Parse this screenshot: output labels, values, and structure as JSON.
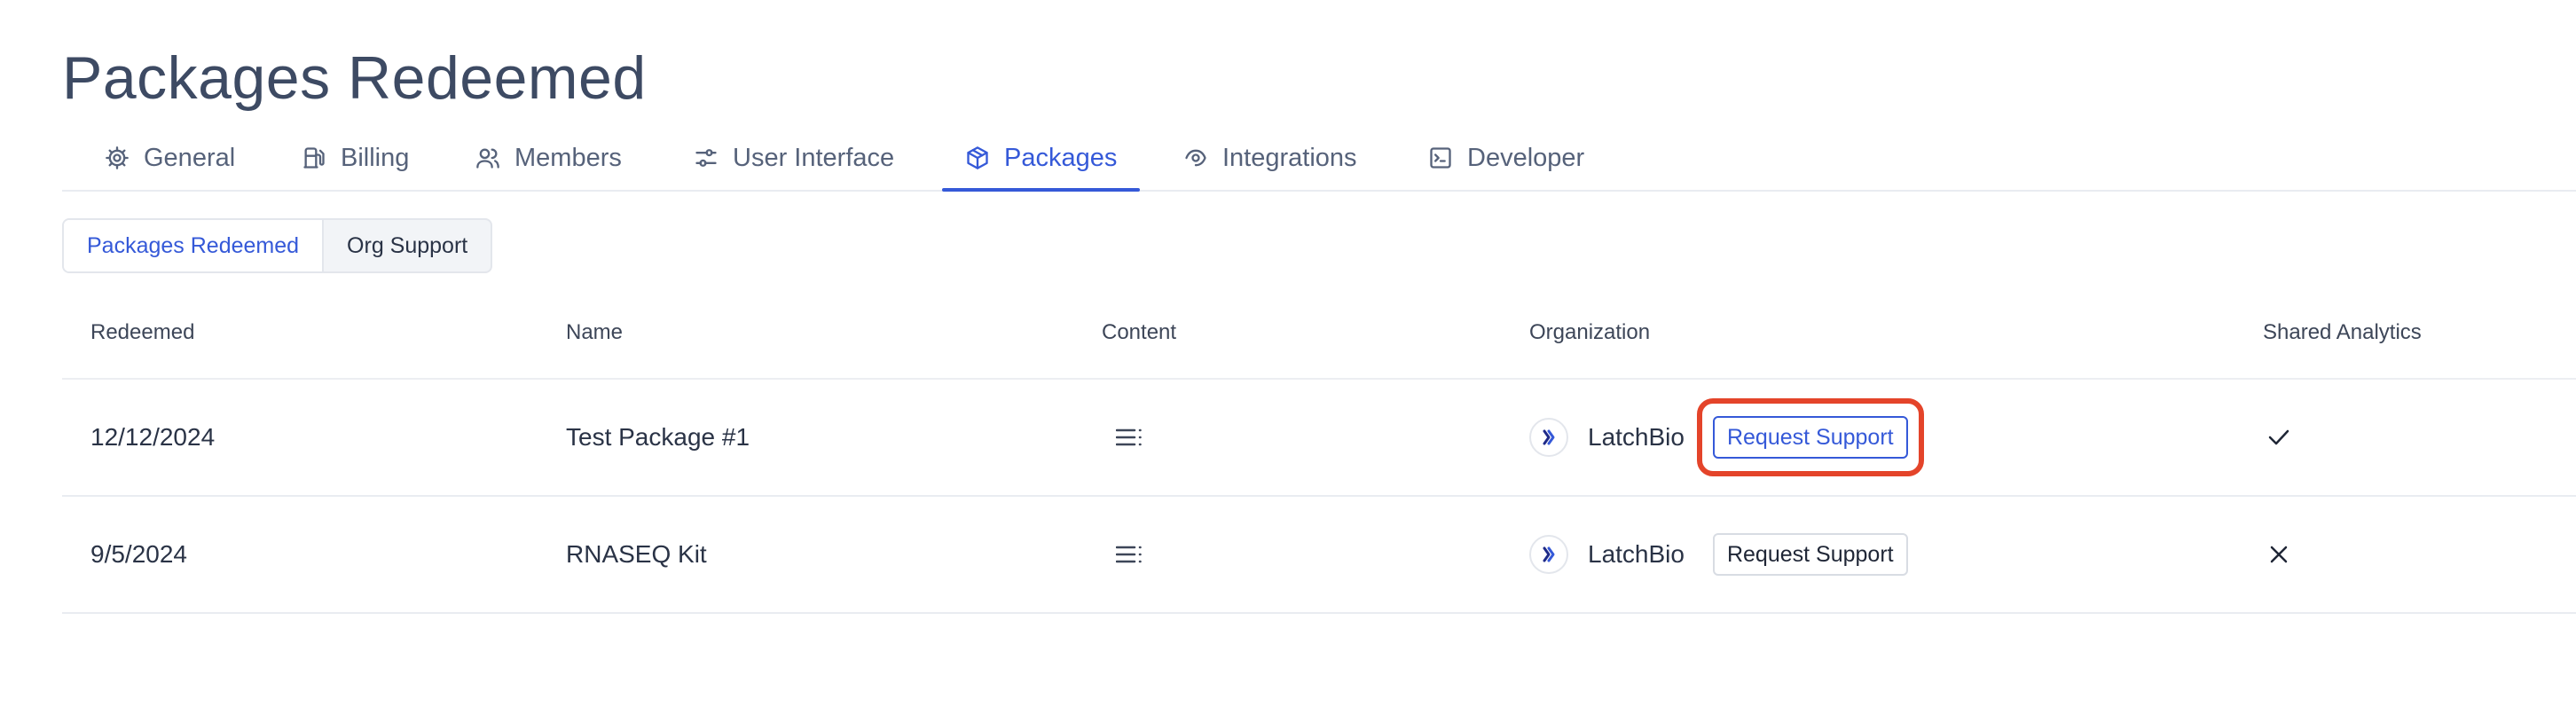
{
  "page": {
    "title": "Packages Redeemed"
  },
  "tabs": [
    {
      "label": "General",
      "icon": "gear-icon"
    },
    {
      "label": "Billing",
      "icon": "fuel-icon"
    },
    {
      "label": "Members",
      "icon": "users-icon"
    },
    {
      "label": "User Interface",
      "icon": "sliders-icon"
    },
    {
      "label": "Packages",
      "icon": "package-icon",
      "active": true
    },
    {
      "label": "Integrations",
      "icon": "integration-icon"
    },
    {
      "label": "Developer",
      "icon": "terminal-icon"
    }
  ],
  "subtabs": [
    {
      "label": "Packages Redeemed",
      "active": true
    },
    {
      "label": "Org Support"
    }
  ],
  "table": {
    "columns": [
      "Redeemed",
      "Name",
      "Content",
      "Organization",
      "Shared Analytics"
    ],
    "rows": [
      {
        "redeemed": "12/12/2024",
        "name": "Test Package #1",
        "content_icon": "list-icon",
        "organization": "LatchBio",
        "action": "Request Support",
        "shared_analytics": "check-icon"
      },
      {
        "redeemed": "9/5/2024",
        "name": "RNASEQ Kit",
        "content_icon": "list-icon",
        "organization": "LatchBio",
        "action": "Request Support",
        "shared_analytics": "x-icon"
      }
    ]
  },
  "colors": {
    "accent": "#3559d8",
    "annotation": "#e4442a"
  }
}
